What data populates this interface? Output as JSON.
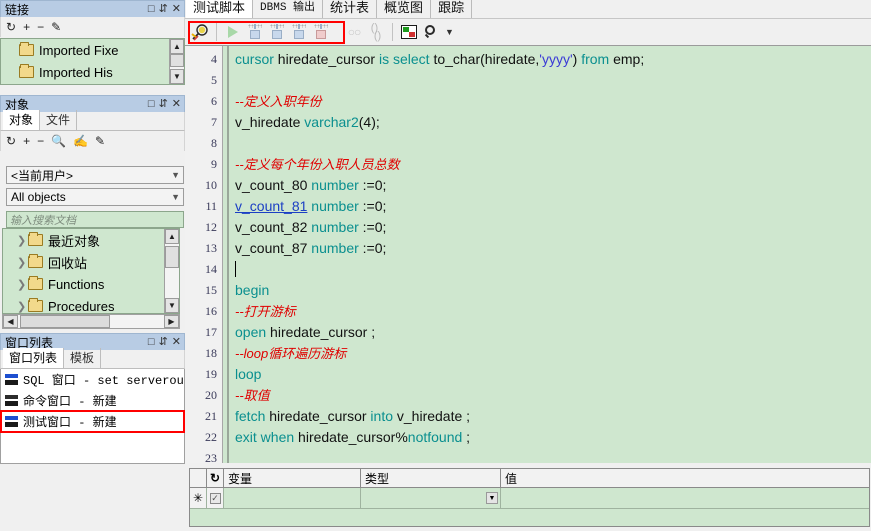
{
  "links_panel": {
    "title": "链接",
    "buttons": [
      "□",
      "⇵",
      "✕"
    ],
    "toolbar_icons": [
      "refresh-icon",
      "add-icon",
      "remove-icon",
      "edit-icon"
    ],
    "items": [
      {
        "label": "Imported Fixe",
        "icon": "folder-icon"
      },
      {
        "label": "Imported His",
        "icon": "folder-icon"
      }
    ]
  },
  "objects_panel": {
    "title": "对象",
    "buttons": [
      "□",
      "⇵",
      "✕"
    ],
    "tabs": [
      {
        "label": "对象",
        "active": true
      },
      {
        "label": "文件",
        "active": false
      }
    ],
    "toolbar_icons": [
      "refresh-icon",
      "add-icon",
      "remove-icon",
      "find-icon",
      "filter-icon",
      "edit-icon"
    ],
    "user_select": "<当前用户>",
    "objects_select": "All objects",
    "search_placeholder": "输入搜索文档",
    "tree": [
      {
        "label": "最近对象",
        "icon": "folder-icon"
      },
      {
        "label": "回收站",
        "icon": "folder-icon"
      },
      {
        "label": "Functions",
        "icon": "folder-icon"
      },
      {
        "label": "Procedures",
        "icon": "folder-icon"
      }
    ]
  },
  "window_list_panel": {
    "title": "窗口列表",
    "buttons": [
      "□",
      "⇵",
      "✕"
    ],
    "tabs": [
      {
        "label": "窗口列表",
        "active": true
      },
      {
        "label": "模板",
        "active": false
      }
    ],
    "items": [
      {
        "label": "SQL 窗口 - set serveroutput",
        "icon": "sql-window-icon",
        "selected": false
      },
      {
        "label": "命令窗口 - 新建",
        "icon": "command-window-icon",
        "selected": false
      },
      {
        "label": "测试窗口 - 新建",
        "icon": "test-window-icon",
        "selected": true
      }
    ]
  },
  "main": {
    "tabs": [
      {
        "label": "测试脚本",
        "active": true
      },
      {
        "label": "DBMS 输出",
        "active": false
      },
      {
        "label": "统计表",
        "active": false
      },
      {
        "label": "概览图",
        "active": false
      },
      {
        "label": "跟踪",
        "active": false
      }
    ],
    "toolbar": [
      {
        "name": "debug-beaker-icon",
        "enabled": true
      },
      {
        "name": "run-icon",
        "enabled": false
      },
      {
        "name": "step-into-icon",
        "enabled": false
      },
      {
        "name": "step-over-icon",
        "enabled": false
      },
      {
        "name": "step-out-icon",
        "enabled": false
      },
      {
        "name": "run-to-exception-icon",
        "enabled": false
      },
      {
        "name": "breakpoints-icon",
        "enabled": false
      },
      {
        "name": "variables-icon",
        "enabled": false
      },
      {
        "name": "output-window-icon",
        "enabled": true
      },
      {
        "name": "zoom-icon",
        "enabled": true
      },
      {
        "name": "zoom-dropdown-arrow-icon",
        "enabled": true
      }
    ]
  },
  "editor": {
    "first_line_number": 4,
    "lines": [
      {
        "n": 4,
        "tokens": [
          {
            "t": "cursor ",
            "c": "kw"
          },
          {
            "t": "hiredate_cursor  ",
            "c": "pln"
          },
          {
            "t": "is ",
            "c": "kw"
          },
          {
            "t": "select ",
            "c": "kw"
          },
          {
            "t": "to_char(hiredate,",
            "c": "pln"
          },
          {
            "t": "'yyyy'",
            "c": "str"
          },
          {
            "t": ") ",
            "c": "pln"
          },
          {
            "t": "from ",
            "c": "kw"
          },
          {
            "t": "emp;",
            "c": "pln"
          }
        ]
      },
      {
        "n": 5,
        "tokens": []
      },
      {
        "n": 6,
        "tokens": [
          {
            "t": "--定义入职年份",
            "c": "cmt"
          }
        ]
      },
      {
        "n": 7,
        "tokens": [
          {
            "t": "v_hiredate ",
            "c": "pln"
          },
          {
            "t": "varchar2",
            "c": "kw"
          },
          {
            "t": "(4);",
            "c": "pln"
          }
        ]
      },
      {
        "n": 8,
        "tokens": []
      },
      {
        "n": 9,
        "tokens": [
          {
            "t": "--定义每个年份入职人员总数",
            "c": "cmt"
          }
        ]
      },
      {
        "n": 10,
        "tokens": [
          {
            "t": "v_count_80 ",
            "c": "pln"
          },
          {
            "t": "number ",
            "c": "kw"
          },
          {
            "t": ":=0;",
            "c": "pln"
          }
        ]
      },
      {
        "n": 11,
        "tokens": [
          {
            "t": "v_count_81",
            "c": "lnk"
          },
          {
            "t": " ",
            "c": "pln"
          },
          {
            "t": "number ",
            "c": "kw"
          },
          {
            "t": ":=0;",
            "c": "pln"
          }
        ]
      },
      {
        "n": 12,
        "tokens": [
          {
            "t": "v_count_82 ",
            "c": "pln"
          },
          {
            "t": "number ",
            "c": "kw"
          },
          {
            "t": ":=0;",
            "c": "pln"
          }
        ]
      },
      {
        "n": 13,
        "tokens": [
          {
            "t": "v_count_87 ",
            "c": "pln"
          },
          {
            "t": "number ",
            "c": "kw"
          },
          {
            "t": ":=0;",
            "c": "pln"
          }
        ]
      },
      {
        "n": 14,
        "tokens": [],
        "caret": true
      },
      {
        "n": 15,
        "tokens": [
          {
            "t": "begin",
            "c": "kw"
          }
        ]
      },
      {
        "n": 16,
        "tokens": [
          {
            "t": "  --打开游标",
            "c": "cmt"
          }
        ]
      },
      {
        "n": 17,
        "tokens": [
          {
            "t": " open ",
            "c": "kw"
          },
          {
            "t": " hiredate_cursor ;",
            "c": "pln"
          }
        ]
      },
      {
        "n": 18,
        "tokens": [
          {
            "t": "--loop循环遍历游标",
            "c": "cmt"
          }
        ]
      },
      {
        "n": 19,
        "tokens": [
          {
            "t": " loop",
            "c": "kw"
          }
        ]
      },
      {
        "n": 20,
        "tokens": [
          {
            "t": "     --取值",
            "c": "cmt"
          }
        ]
      },
      {
        "n": 21,
        "tokens": [
          {
            "t": "   fetch ",
            "c": "kw"
          },
          {
            "t": "hiredate_cursor ",
            "c": "pln"
          },
          {
            "t": "into ",
            "c": "kw"
          },
          {
            "t": " v_hiredate ;",
            "c": "pln"
          }
        ]
      },
      {
        "n": 22,
        "tokens": [
          {
            "t": "   exit when ",
            "c": "kw"
          },
          {
            "t": " hiredate_cursor%",
            "c": "pln"
          },
          {
            "t": "notfound",
            "c": "kw"
          },
          {
            "t": " ;",
            "c": "pln"
          }
        ]
      },
      {
        "n": 23,
        "tokens": []
      }
    ]
  },
  "variables_grid": {
    "columns": [
      "",
      "↻",
      "变量",
      "类型",
      "值"
    ],
    "new_row_marker": "✳",
    "rows": [
      {
        "marker": "✳",
        "checked": true,
        "变量": "",
        "类型": "",
        "值": ""
      }
    ]
  },
  "colors": {
    "editor_bg": "#cfe7cf",
    "keyword": "#0a8f8f",
    "comment": "#e00000",
    "string": "#3a3ad6",
    "highlight_box": "#ff0000",
    "titlebar": "#b8cce4"
  }
}
